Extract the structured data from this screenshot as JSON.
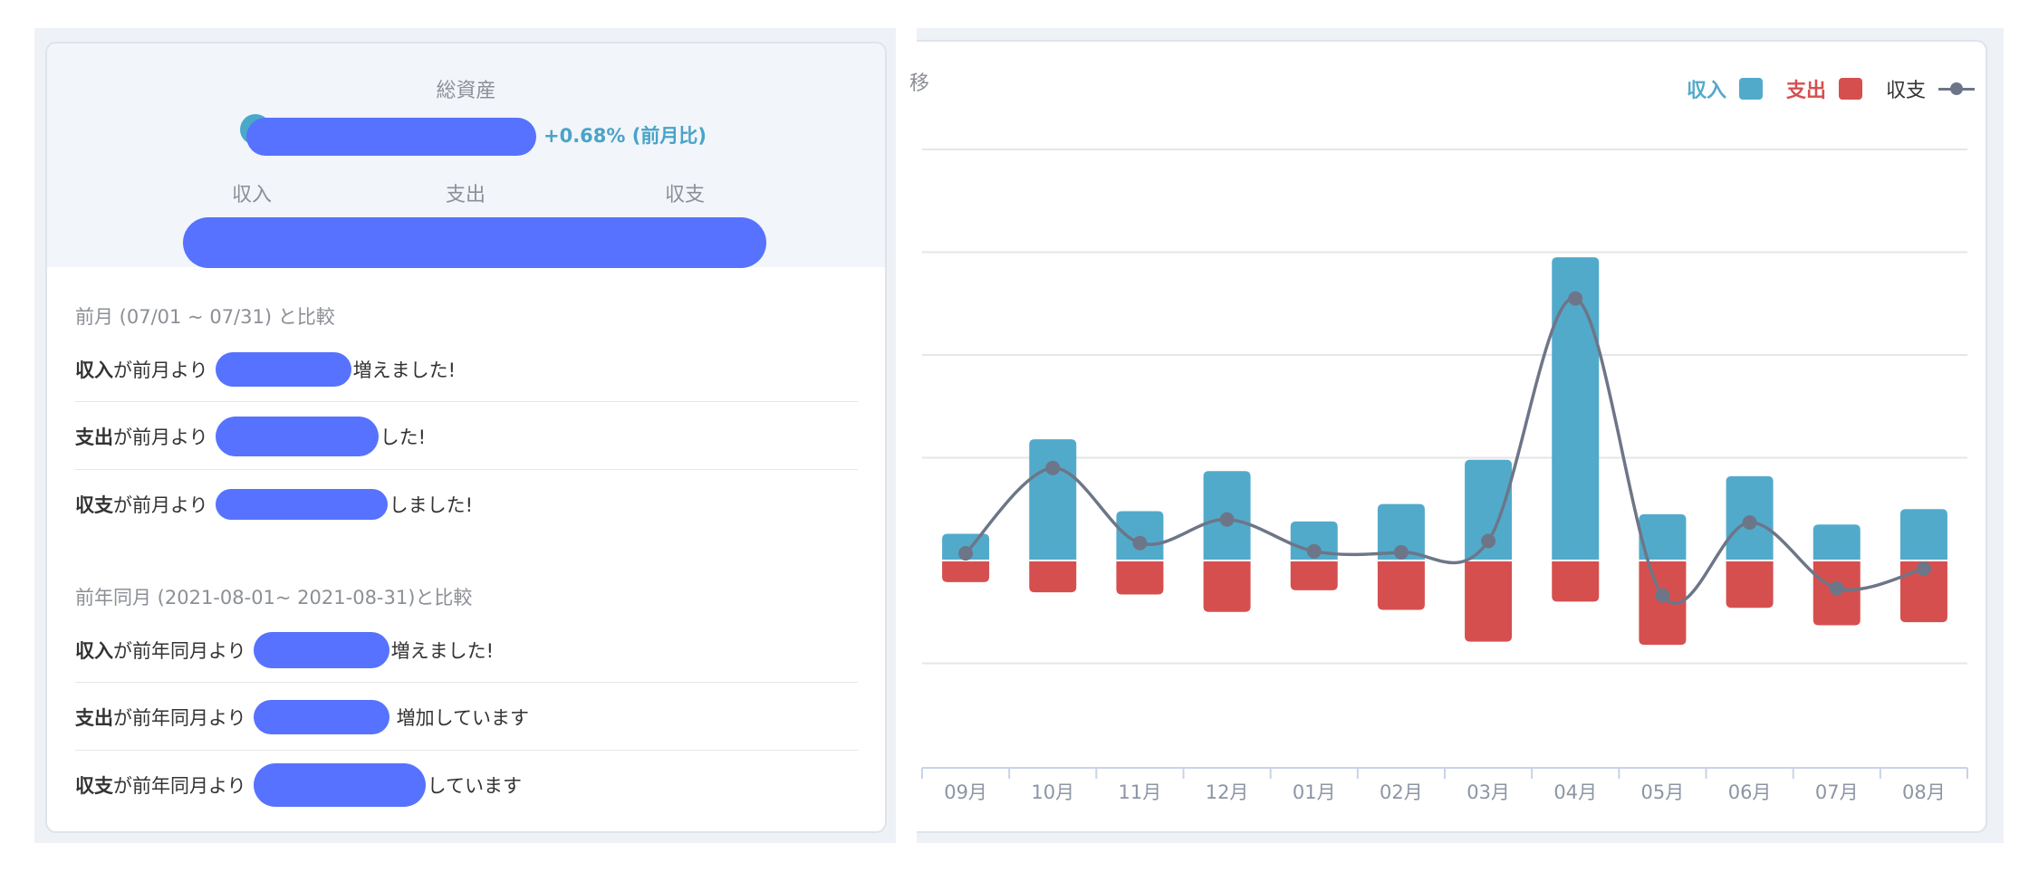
{
  "summary": {
    "total_assets_label": "総資産",
    "total_assets_change": "+0.68% (前月比)",
    "columns": [
      "収入",
      "支出",
      "収支"
    ]
  },
  "comparison_prev_month": {
    "title": "前月 (07/01 ~ 07/31) と比較",
    "rows": [
      {
        "keyword": "収入",
        "prefix": "が前月より",
        "suffix": "増えました!"
      },
      {
        "keyword": "支出",
        "prefix": "が前月より",
        "suffix": "した!"
      },
      {
        "keyword": "収支",
        "prefix": "が前月より",
        "suffix": "しました!"
      }
    ]
  },
  "comparison_prev_year": {
    "title": "前年同月 (2021-08-01~ 2021-08-31)と比較",
    "rows": [
      {
        "keyword": "収入",
        "prefix": "が前年同月より",
        "suffix": "増えました!"
      },
      {
        "keyword": "支出",
        "prefix": "が前年同月より",
        "suffix": "増加しています"
      },
      {
        "keyword": "収支",
        "prefix": "が前年同月より",
        "suffix": "しています"
      }
    ]
  },
  "chart_title_fragment": "移",
  "legend": {
    "income": "収入",
    "expense": "支出",
    "balance": "収支"
  },
  "colors": {
    "income": "#52aacb",
    "expense": "#d64f4f",
    "balance": "#6d7688",
    "redaction": "#5672ff"
  },
  "chart_data": {
    "type": "bar",
    "categories": [
      "09月",
      "10月",
      "11月",
      "12月",
      "01月",
      "02月",
      "03月",
      "04月",
      "05月",
      "06月",
      "07月",
      "08月"
    ],
    "ylim": [
      -200,
      400
    ],
    "grid": true,
    "legend_position": "top-right",
    "series": [
      {
        "name": "収入",
        "values": [
          26,
          118,
          48,
          87,
          38,
          55,
          98,
          295,
          45,
          82,
          35,
          50
        ]
      },
      {
        "name": "支出",
        "values": [
          -21,
          -31,
          -33,
          -50,
          -29,
          -48,
          -79,
          -40,
          -82,
          -46,
          -63,
          -60
        ]
      },
      {
        "name": "収支",
        "values": [
          7,
          90,
          17,
          40,
          9,
          8,
          19,
          255,
          -34,
          37,
          -27,
          -8
        ]
      }
    ]
  }
}
